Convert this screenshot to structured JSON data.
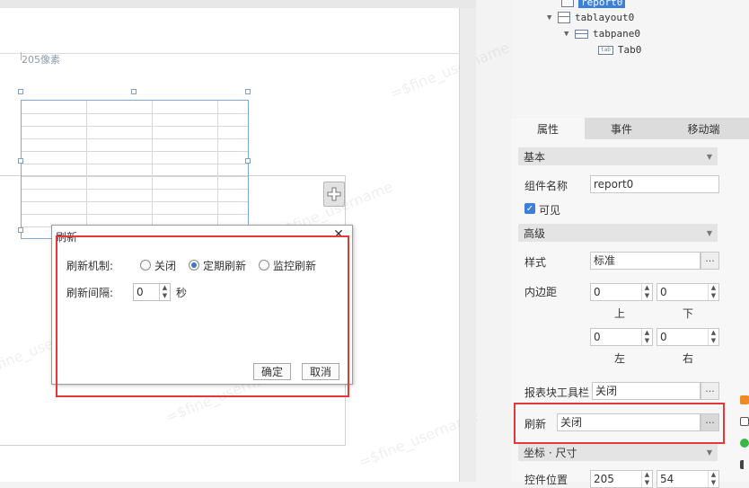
{
  "canvas": {
    "width_label": "205像素",
    "watermark": "=$fine_username"
  },
  "dialog": {
    "title": "刷新",
    "refresh_mode_label": "刷新机制:",
    "options": [
      "关闭",
      "定期刷新",
      "监控刷新"
    ],
    "selected_option": "定期刷新",
    "interval_label": "刷新间隔:",
    "interval_value": "0",
    "interval_unit": "秒",
    "ok_label": "确定",
    "cancel_label": "取消"
  },
  "tree": {
    "items": [
      "report0",
      "tablayout0",
      "tabpane0",
      "Tab0"
    ],
    "tab_icon_text": "tab"
  },
  "tabs": [
    "属性",
    "事件",
    "移动端"
  ],
  "props": {
    "basic_section": "基本",
    "component_name_label": "组件名称",
    "component_name_value": "report0",
    "visible_label": "可见",
    "advanced_section": "高级",
    "style_label": "样式",
    "style_value": "标准",
    "padding_label": "内边距",
    "padding_top": "0",
    "padding_bottom": "0",
    "padding_left": "0",
    "padding_right": "0",
    "top_label": "上",
    "bottom_label": "下",
    "left_label": "左",
    "right_label": "右",
    "toolbar_label": "报表块工具栏",
    "toolbar_value": "关闭",
    "refresh_label": "刷新",
    "refresh_value": "关闭",
    "coords_section": "坐标 · 尺寸",
    "position_label": "控件位置",
    "position_x": "205",
    "position_y": "54"
  },
  "colors": {
    "accent": "#3d7fd6",
    "highlight": "#e53838"
  }
}
